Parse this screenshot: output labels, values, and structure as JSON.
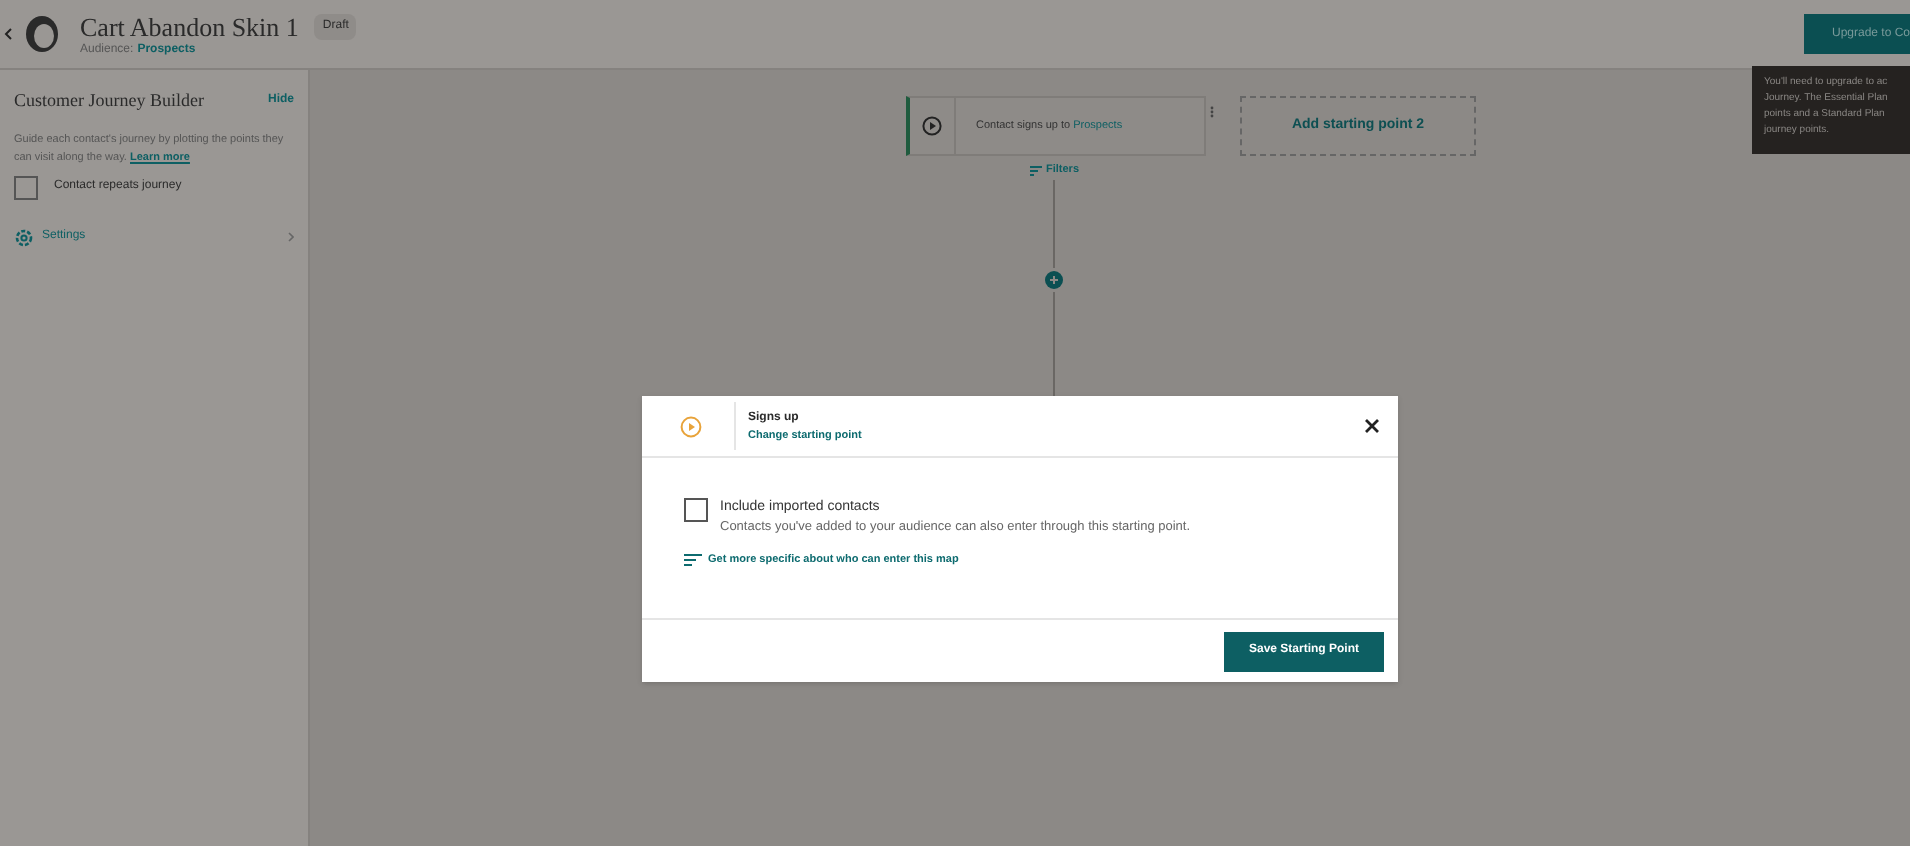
{
  "header": {
    "title": "Cart Abandon Skin 1",
    "badge": "Draft",
    "audience_label": "Audience:",
    "audience": "Prospects",
    "upgrade_button": "Upgrade to Co"
  },
  "tooltip": {
    "lines": [
      "You'll need to upgrade to ac",
      "Journey. The Essential Plan",
      "points and a Standard Plan",
      "journey points."
    ]
  },
  "sidebar": {
    "title": "Customer Journey Builder",
    "hide": "Hide",
    "description": "Guide each contact's journey by plotting the points they can visit along the way.",
    "learn_more": "Learn more",
    "repeat": {
      "label": "Contact repeats journey",
      "checked": false
    },
    "settings": "Settings"
  },
  "canvas": {
    "start_card": {
      "text": "Contact signs up to",
      "audience": "Prospects"
    },
    "add_start": "Add starting point 2",
    "filters": "Filters"
  },
  "modal": {
    "title": "Signs up",
    "change_link": "Change starting point",
    "include": {
      "label": "Include imported contacts",
      "checked": false,
      "description": "Contacts you've added to your audience can also enter through this starting point."
    },
    "specific_link": "Get more specific about who can enter this map",
    "save_button": "Save Starting Point"
  }
}
